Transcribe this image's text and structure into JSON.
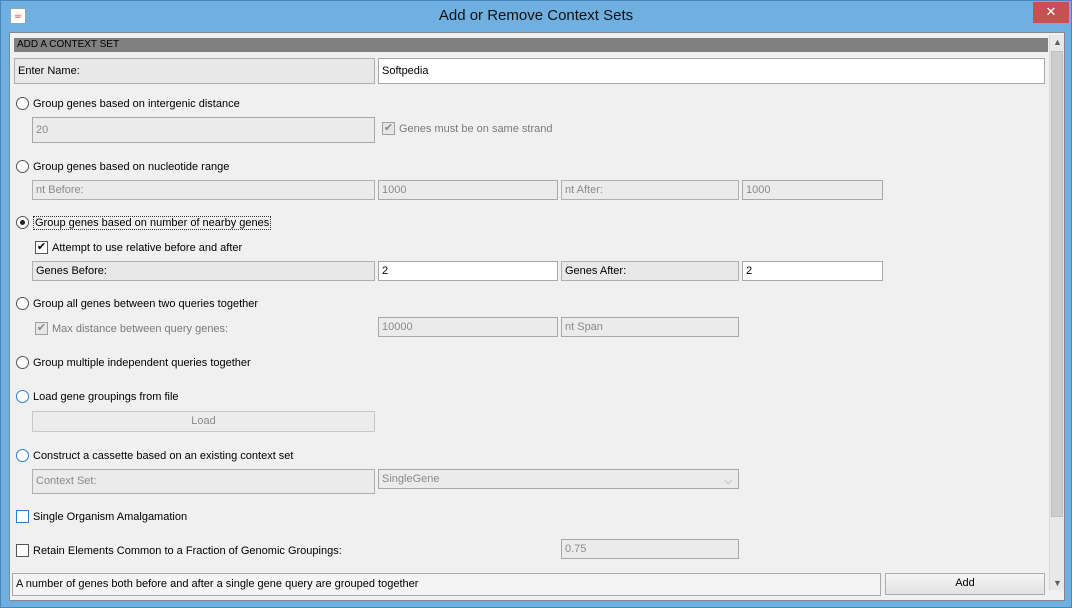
{
  "window": {
    "title": "Add or Remove Context Sets",
    "close_glyph": "✕",
    "app_icon_glyph": "☕"
  },
  "header": {
    "label": "ADD A CONTEXT SET"
  },
  "name_row": {
    "label": "Enter Name:",
    "value": "Softpedia"
  },
  "options": {
    "intergenic": {
      "label": "Group genes based on intergenic distance",
      "selected": false,
      "distance_value": "20",
      "same_strand_label": "Genes must be on same strand",
      "same_strand_checked": true
    },
    "nucleotide": {
      "label": "Group genes based on nucleotide range",
      "selected": false,
      "nt_before_label": "nt Before:",
      "nt_before_value": "1000",
      "nt_after_label": "nt After:",
      "nt_after_value": "1000"
    },
    "nearby": {
      "label": "Group genes based on number of nearby genes",
      "selected": true,
      "relative_label": "Attempt to use relative before and after",
      "relative_checked": true,
      "genes_before_label": "Genes Before:",
      "genes_before_value": "2",
      "genes_after_label": "Genes After:",
      "genes_after_value": "2"
    },
    "between": {
      "label": "Group all genes between two queries together",
      "selected": false,
      "max_distance_label": "Max distance between query genes:",
      "max_distance_checked": true,
      "max_distance_value": "10000",
      "span_placeholder": "nt Span"
    },
    "independent": {
      "label": "Group multiple independent queries together",
      "selected": false
    },
    "file": {
      "label": "Load gene groupings from file",
      "selected": false,
      "load_button": "Load"
    },
    "cassette": {
      "label": "Construct a cassette based on an existing context set",
      "selected": false,
      "context_set_label": "Context Set:",
      "context_set_value": "SingleGene"
    }
  },
  "single_organism": {
    "label": "Single Organism Amalgamation",
    "checked": false
  },
  "retain": {
    "label": "Retain Elements Common to a Fraction of Genomic Groupings:",
    "checked": false,
    "value": "0.75"
  },
  "footer": {
    "description": "A number of genes both before and after a single gene query are grouped together",
    "add_button": "Add"
  },
  "icons": {
    "checkmark": "✔",
    "dropdown": "⌵",
    "scroll_up": "▲",
    "scroll_down": "▼",
    "scroll_left": "◀",
    "scroll_right": "▶"
  }
}
